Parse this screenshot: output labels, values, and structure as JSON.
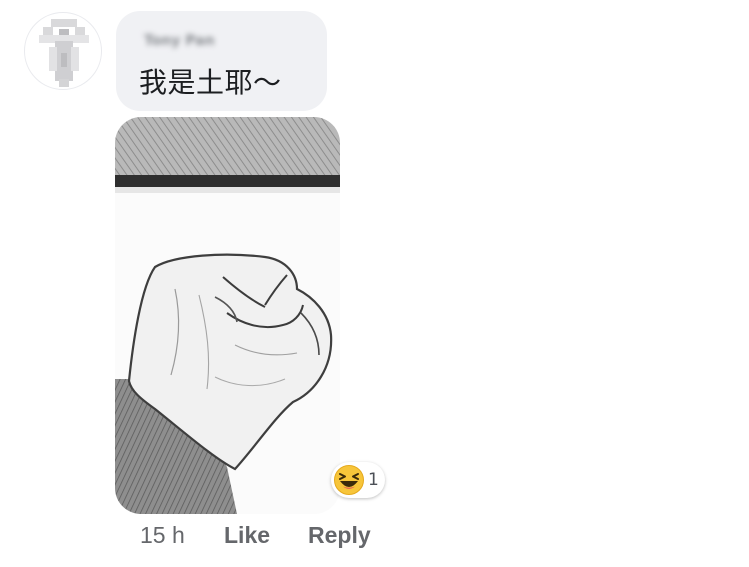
{
  "comment": {
    "author_name": "Tony Pan",
    "text": "我是土耶～",
    "photo_alt": "fist-sketch-photo"
  },
  "reactions": {
    "icon": "laughing-face-icon",
    "count": "1"
  },
  "actions": {
    "time": "15 h",
    "like_label": "Like",
    "reply_label": "Reply"
  },
  "colors": {
    "bubble_bg": "#f0f1f4",
    "text": "#1c1e21",
    "meta_text": "#65676b",
    "emoji_yellow": "#f7c53a"
  }
}
